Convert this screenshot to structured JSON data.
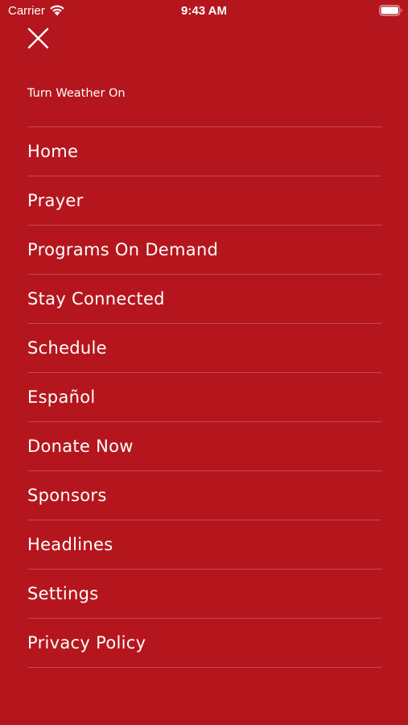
{
  "status_bar": {
    "carrier": "Carrier",
    "time": "9:43 AM",
    "wifi_icon": "wifi-icon",
    "battery_icon": "battery-icon"
  },
  "close_icon": "close-icon",
  "weather_toggle_label": "Turn Weather On",
  "colors": {
    "background": "#b5161d",
    "text": "#ffffff",
    "divider": "rgba(255,255,255,0.22)"
  },
  "menu": {
    "items": [
      {
        "label": "Home"
      },
      {
        "label": "Prayer"
      },
      {
        "label": "Programs On Demand"
      },
      {
        "label": "Stay Connected"
      },
      {
        "label": "Schedule"
      },
      {
        "label": "Español"
      },
      {
        "label": "Donate Now"
      },
      {
        "label": "Sponsors"
      },
      {
        "label": "Headlines"
      },
      {
        "label": "Settings"
      },
      {
        "label": "Privacy Policy"
      }
    ]
  }
}
